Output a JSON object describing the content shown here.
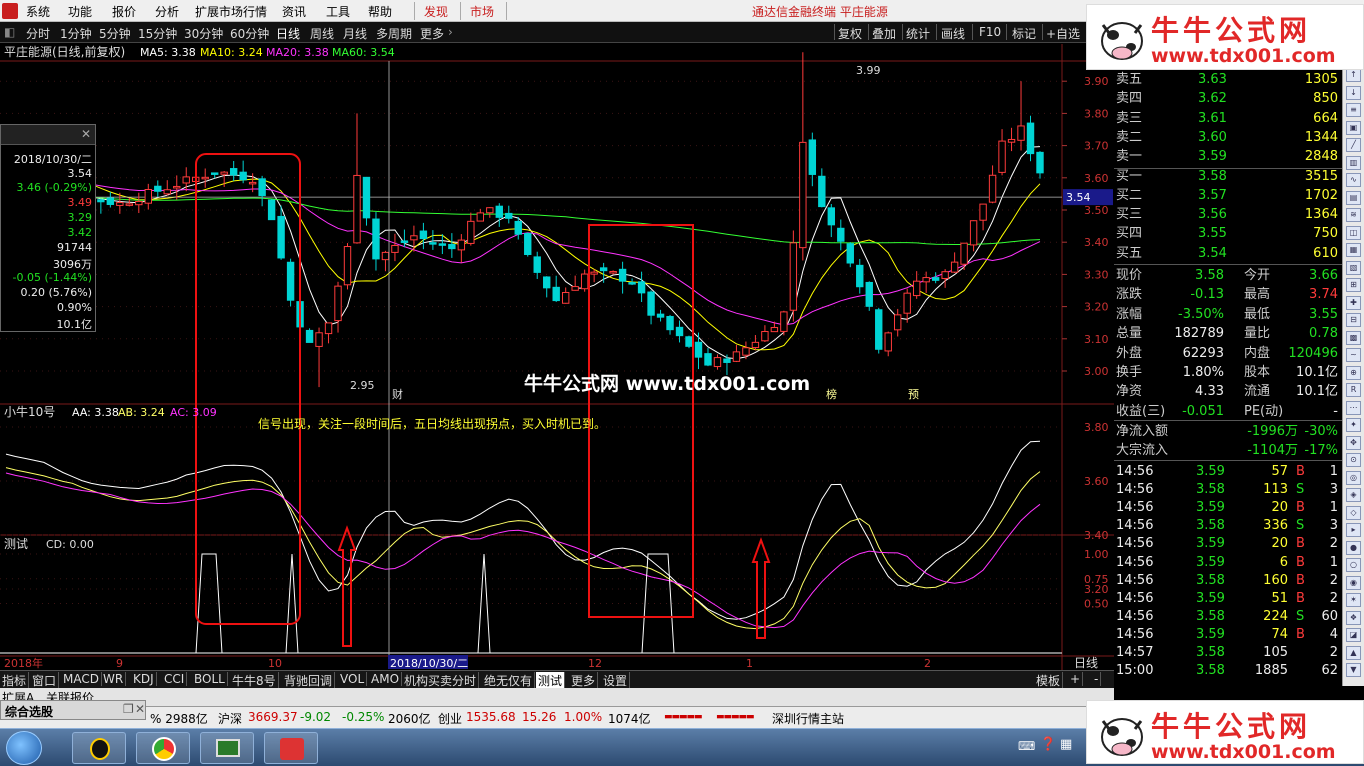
{
  "menu": {
    "items": [
      "系统",
      "功能",
      "报价",
      "分析",
      "扩展市场行情",
      "资讯",
      "工具",
      "帮助"
    ],
    "discover": "发现",
    "market": "市场",
    "app_title": "通达信金融终端 平庄能源"
  },
  "toolbar": {
    "periods": [
      "分时",
      "1分钟",
      "5分钟",
      "15分钟",
      "30分钟",
      "60分钟",
      "日线",
      "周线",
      "月线",
      "多周期",
      "更多"
    ],
    "right": [
      "复权",
      "叠加",
      "统计",
      "画线",
      "F10",
      "标记",
      "+自选"
    ]
  },
  "main_chart": {
    "title": "平庄能源(日线,前复权)",
    "ma5": "MA5: 3.38",
    "ma10": "MA10: 3.24",
    "ma20": "MA20: 3.38",
    "ma60": "MA60: 3.54",
    "y_ticks": [
      "3.90",
      "3.80",
      "3.70",
      "3.60",
      "3.50",
      "3.40",
      "3.30",
      "3.20",
      "3.10",
      "3.00"
    ],
    "price_tag": "3.54",
    "high_label": "3.99",
    "low_label": "2.95",
    "marker_cai": "财",
    "marker_bang": "榜",
    "marker_yu": "预",
    "watermark": "牛牛公式网  www.tdx001.com"
  },
  "popup": {
    "date": "2018/10/30/二",
    "values": [
      "3.54",
      "3.46 (-0.29%)",
      "3.49",
      "3.29",
      "3.42",
      "91744",
      "3096万",
      "-0.05 (-1.44%)",
      "0.20 (5.76%)",
      "0.90%",
      "10.1亿"
    ]
  },
  "indicator1": {
    "name": "小牛10号",
    "aa": "AA: 3.38",
    "ab": "AB: 3.24",
    "ac": "AC: 3.09",
    "y_ticks": [
      "3.80",
      "3.60",
      "3.40",
      "3.20"
    ],
    "note": "信号出现，关注一段时间后，五日均线出现拐点，买入时机已到。"
  },
  "indicator2": {
    "name": "测试",
    "cd": "CD: 0.00",
    "y_ticks": [
      "1.00",
      "0.75",
      "0.50"
    ]
  },
  "x_axis": {
    "labels": [
      "2018年",
      "9",
      "10",
      "2018/10/30/二",
      "12",
      "1",
      "2"
    ],
    "period": "日线"
  },
  "bottom_tabs": [
    "指标",
    "窗口",
    "MACD",
    "WR",
    "KDJ",
    "CCI",
    "BOLL",
    "牛牛8号",
    "背驰回调",
    "VOL",
    "AMO",
    "机构买卖分时",
    "绝无仅有",
    "测试",
    "更多",
    "设置"
  ],
  "bottom_right": [
    "模板",
    "+",
    "-"
  ],
  "sub_tabs": [
    "扩展A",
    "关联报价"
  ],
  "order_book": [
    {
      "label": "卖五",
      "price": "3.63",
      "vol": "1305"
    },
    {
      "label": "卖四",
      "price": "3.62",
      "vol": "850"
    },
    {
      "label": "卖三",
      "price": "3.61",
      "vol": "664"
    },
    {
      "label": "卖二",
      "price": "3.60",
      "vol": "1344"
    },
    {
      "label": "卖一",
      "price": "3.59",
      "vol": "2848"
    },
    {
      "label": "买一",
      "price": "3.58",
      "vol": "3515"
    },
    {
      "label": "买二",
      "price": "3.57",
      "vol": "1702"
    },
    {
      "label": "买三",
      "price": "3.56",
      "vol": "1364"
    },
    {
      "label": "买四",
      "price": "3.55",
      "vol": "750"
    },
    {
      "label": "买五",
      "price": "3.54",
      "vol": "610"
    }
  ],
  "stats": [
    {
      "l1": "现价",
      "v1": "3.58",
      "l2": "今开",
      "v2": "3.66"
    },
    {
      "l1": "涨跌",
      "v1": "-0.13",
      "l2": "最高",
      "v2": "3.74"
    },
    {
      "l1": "涨幅",
      "v1": "-3.50%",
      "l2": "最低",
      "v2": "3.55"
    },
    {
      "l1": "总量",
      "v1": "182789",
      "l2": "量比",
      "v2": "0.78"
    },
    {
      "l1": "外盘",
      "v1": "62293",
      "l2": "内盘",
      "v2": "120496"
    },
    {
      "l1": "换手",
      "v1": "1.80%",
      "l2": "股本",
      "v2": "10.1亿"
    },
    {
      "l1": "净资",
      "v1": "4.33",
      "l2": "流通",
      "v2": "10.1亿"
    },
    {
      "l1": "收益(三)",
      "v1": "-0.051",
      "l2": "PE(动)",
      "v2": "-"
    }
  ],
  "flows": [
    {
      "label": "净流入额",
      "v1": "-1996万",
      "v2": "-30%"
    },
    {
      "label": "大宗流入",
      "v1": "-1104万",
      "v2": "-17%"
    }
  ],
  "ticks": [
    {
      "t": "14:56",
      "p": "3.59",
      "v": "57",
      "d": "B",
      "n": "1"
    },
    {
      "t": "14:56",
      "p": "3.58",
      "v": "113",
      "d": "S",
      "n": "3"
    },
    {
      "t": "14:56",
      "p": "3.59",
      "v": "20",
      "d": "B",
      "n": "1"
    },
    {
      "t": "14:56",
      "p": "3.58",
      "v": "336",
      "d": "S",
      "n": "3"
    },
    {
      "t": "14:56",
      "p": "3.59",
      "v": "20",
      "d": "B",
      "n": "2"
    },
    {
      "t": "14:56",
      "p": "3.59",
      "v": "6",
      "d": "B",
      "n": "1"
    },
    {
      "t": "14:56",
      "p": "3.58",
      "v": "160",
      "d": "B",
      "n": "2"
    },
    {
      "t": "14:56",
      "p": "3.59",
      "v": "51",
      "d": "B",
      "n": "2"
    },
    {
      "t": "14:56",
      "p": "3.58",
      "v": "224",
      "d": "S",
      "n": "60"
    },
    {
      "t": "14:56",
      "p": "3.59",
      "v": "74",
      "d": "B",
      "n": "4"
    },
    {
      "t": "14:57",
      "p": "3.58",
      "v": "105",
      "d": "",
      "n": "2"
    },
    {
      "t": "15:00",
      "p": "3.58",
      "v": "1885",
      "d": "",
      "n": "62"
    }
  ],
  "status": {
    "a": "% 2988亿",
    "sh_label": "沪深",
    "sh_val": "3669.37",
    "sh_chg": "-9.02",
    "sh_pct": "-0.25%",
    "sh_amt": "2060亿",
    "cy_label": "创业",
    "cy_val": "1535.68",
    "cy_chg": "15.26",
    "cy_pct": "1.00%",
    "cy_amt": "1074亿",
    "server": "深圳行情主站",
    "zhsx": "综合选股"
  },
  "watermark": {
    "title": "牛牛公式网",
    "url": "www.tdx001.com"
  },
  "colors": {
    "up": "#ff3b3b",
    "down": "#00d4d4",
    "ma5": "#ffffff",
    "ma10": "#ffff00",
    "ma20": "#ff33ff",
    "ma60": "#33ff33"
  }
}
